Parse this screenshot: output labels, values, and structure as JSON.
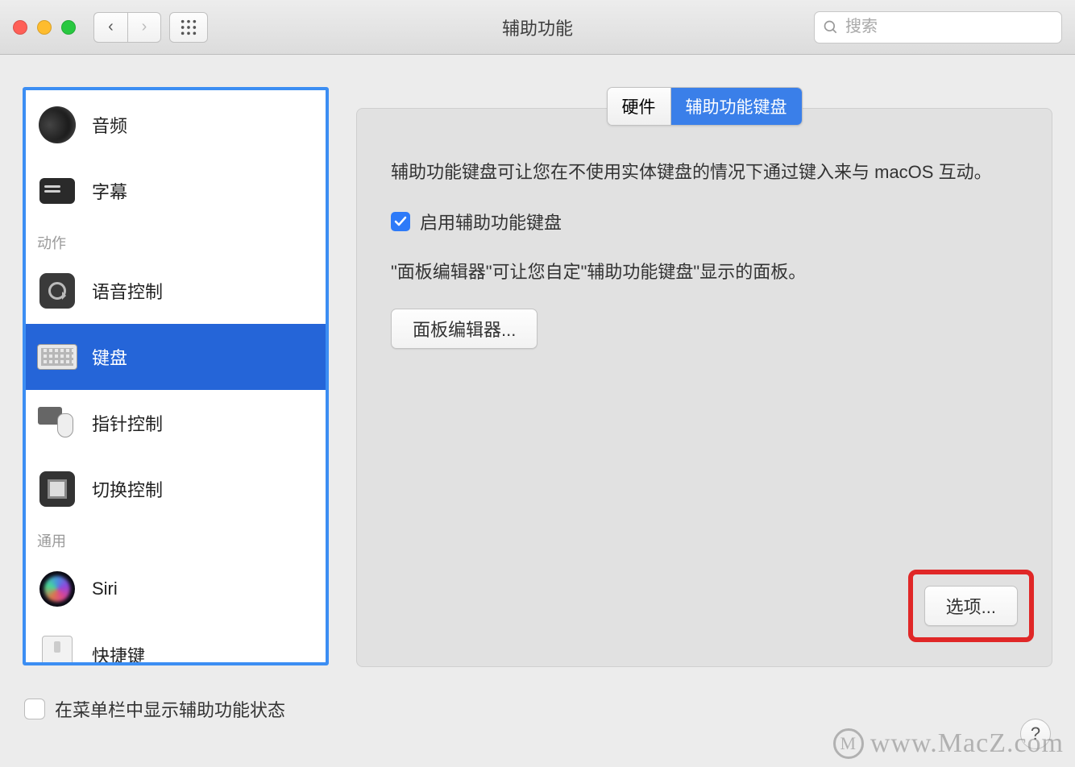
{
  "window": {
    "title": "辅助功能"
  },
  "toolbar": {
    "search_placeholder": "搜索"
  },
  "sidebar": {
    "headers": {
      "actions": "动作",
      "general": "通用"
    },
    "items": {
      "audio": "音频",
      "captions": "字幕",
      "voice_control": "语音控制",
      "keyboard": "键盘",
      "pointer_control": "指针控制",
      "switch_control": "切换控制",
      "siri": "Siri",
      "shortcut": "快捷键"
    }
  },
  "tabs": {
    "hardware": "硬件",
    "accessibility_keyboard": "辅助功能键盘"
  },
  "panel": {
    "description": "辅助功能键盘可让您在不使用实体键盘的情况下通过键入来与 macOS 互动。",
    "enable_label": "启用辅助功能键盘",
    "panel_editor_desc": "\"面板编辑器\"可让您自定\"辅助功能键盘\"显示的面板。",
    "panel_editor_button": "面板编辑器...",
    "options_button": "选项..."
  },
  "footer": {
    "menubar_label": "在菜单栏中显示辅助功能状态"
  },
  "watermark": "www.MacZ.com"
}
